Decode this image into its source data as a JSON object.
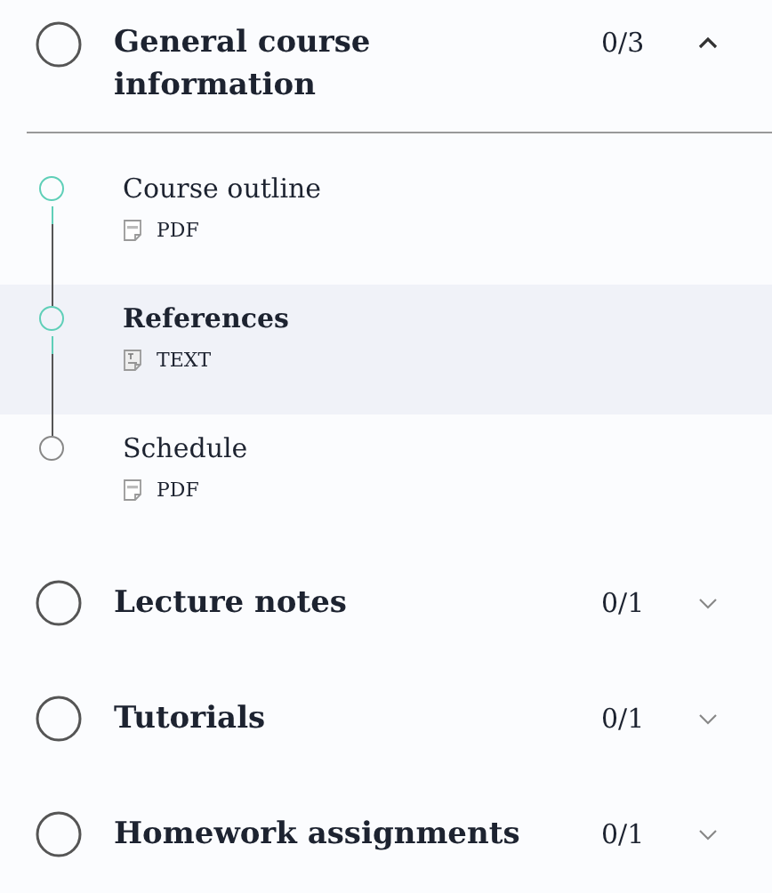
{
  "sections": [
    {
      "title": "General course information",
      "progress": "0/3",
      "level": 0,
      "expanded": true,
      "lessons": [
        {
          "title": "Course outline",
          "type": "PDF",
          "kind": "pdf",
          "visited": true,
          "selected": false
        },
        {
          "title": "References",
          "type": "TEXT",
          "kind": "text",
          "visited": true,
          "selected": true
        },
        {
          "title": "Schedule",
          "type": "PDF",
          "kind": "pdf",
          "visited": false,
          "selected": false
        }
      ]
    },
    {
      "title": "Lecture notes",
      "progress": "0/1",
      "level": 0,
      "expanded": false
    },
    {
      "title": "Tutorials",
      "progress": "0/1",
      "level": 0,
      "expanded": false
    },
    {
      "title": "Homework assignments",
      "progress": "0/1",
      "level": 0,
      "expanded": false
    }
  ]
}
